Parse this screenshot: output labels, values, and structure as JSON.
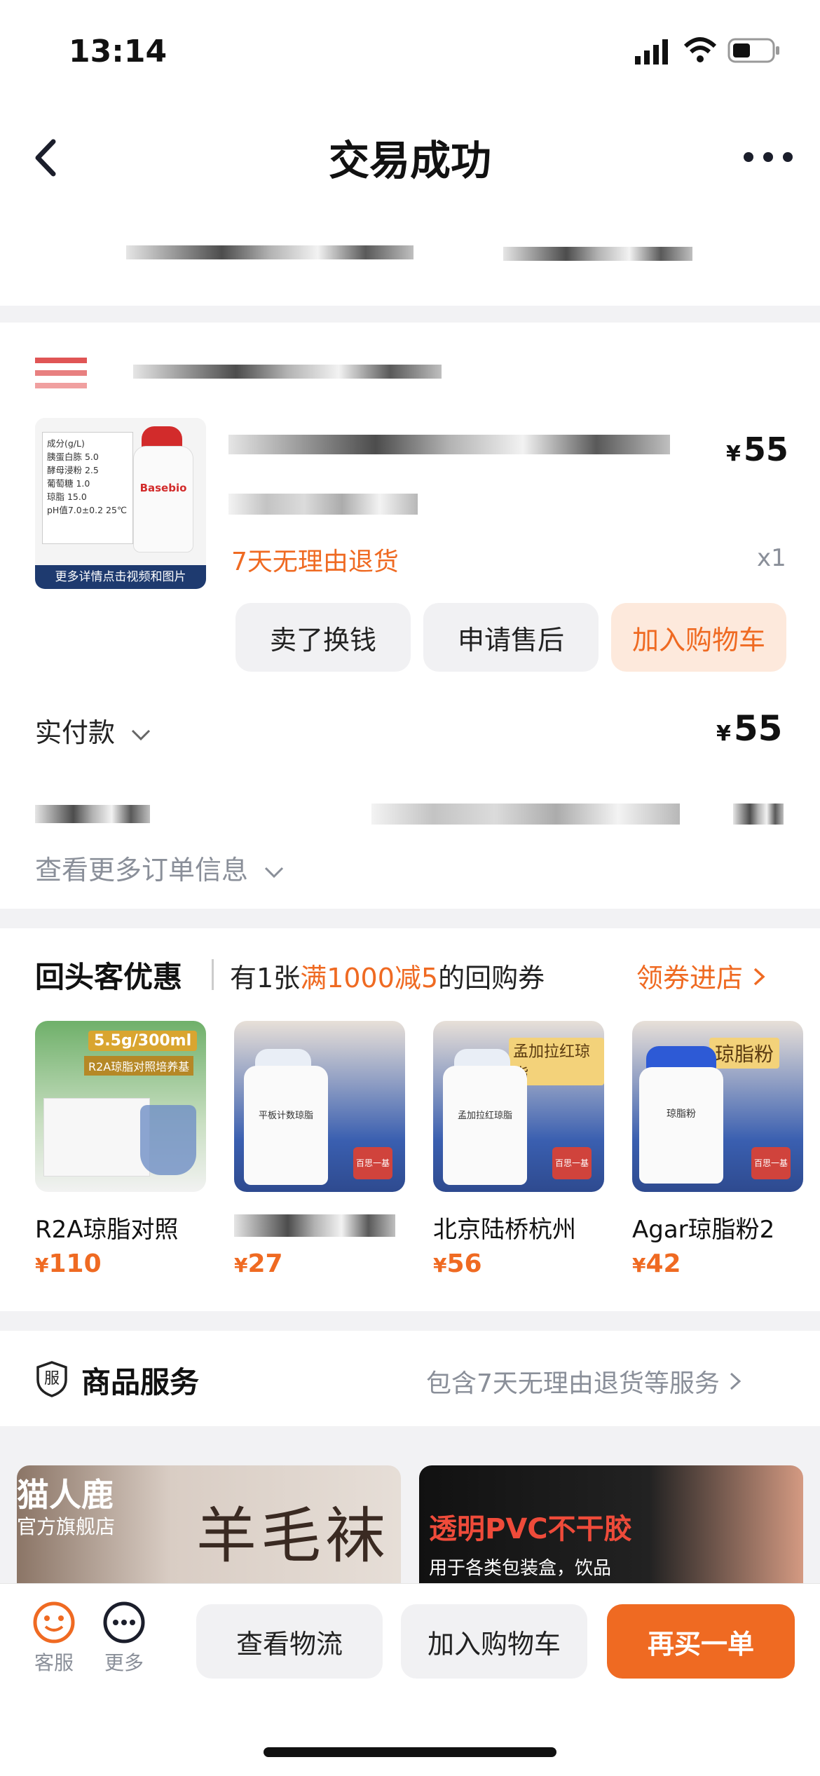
{
  "status_bar": {
    "time": "13:14"
  },
  "header": {
    "title": "交易成功"
  },
  "order": {
    "product": {
      "image_text_lines": [
        "成分(g/L)",
        "胰蛋白胨  5.0",
        "酵母浸粉  2.5",
        "葡萄糖  1.0",
        "琼脂  15.0",
        "pH值7.0±0.2  25℃"
      ],
      "image_brand": "Basebio",
      "image_caption": "更多详情点击视频和图片",
      "price_symbol": "¥",
      "price": "55",
      "return_policy": "7天无理由退货",
      "quantity": "x1"
    },
    "actions": [
      "卖了换钱",
      "申请售后",
      "加入购物车"
    ],
    "paid_label": "实付款",
    "paid_symbol": "¥",
    "paid_amount": "55",
    "more_info": "查看更多订单信息"
  },
  "returning": {
    "title": "回头客优惠",
    "coupon_prefix": "有1张",
    "coupon_highlight": "满1000减5",
    "coupon_suffix": "的回购券",
    "link": "领券进店",
    "items": [
      {
        "title": "R2A琼脂对照",
        "price_symbol": "¥",
        "price": "110",
        "tag": "5.5g/300ml",
        "sub_tag": "R2A琼脂对照培养基"
      },
      {
        "title": "",
        "price_symbol": "¥",
        "price": "27",
        "tag": "",
        "bottle_label": "平板计数琼脂"
      },
      {
        "title": "北京陆桥杭州",
        "price_symbol": "¥",
        "price": "56",
        "tag": "孟加拉红琼脂",
        "bottle_label": "孟加拉红琼脂"
      },
      {
        "title": "Agar琼脂粉2",
        "price_symbol": "¥",
        "price": "42",
        "tag": "琼脂粉",
        "bottle_label": "琼脂粉"
      }
    ],
    "brand_badge": "百思一基"
  },
  "service": {
    "icon_text": "服",
    "title": "商品服务",
    "desc": "包含7天无理由退货等服务"
  },
  "ads": [
    {
      "brand": "猫人鹿",
      "sub": "官方旗舰店",
      "headline": "羊毛袜"
    },
    {
      "headline": "透明PVC不干胶",
      "sub": "用于各类包装盒，饮品"
    }
  ],
  "bottom_bar": {
    "service_label": "客服",
    "more_label": "更多",
    "logistics": "查看物流",
    "add_cart": "加入购物车",
    "buy_again": "再买一单"
  },
  "colors": {
    "accent": "#ef6a22",
    "accent_light": "#fde9dc"
  }
}
